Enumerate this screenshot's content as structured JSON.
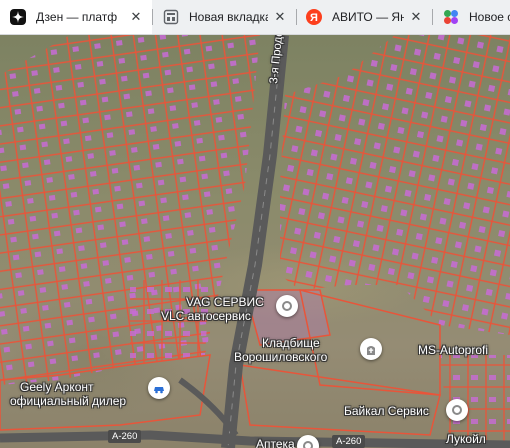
{
  "tabs": [
    {
      "title": "Дзен — платф",
      "favicon": "dzen-icon",
      "active": true
    },
    {
      "title": "Новая вкладка",
      "favicon": "new-tab-icon"
    },
    {
      "title": "АВИТО — Янд",
      "favicon": "yandex-icon"
    },
    {
      "title": "Новое с",
      "favicon": "apps-icon"
    }
  ],
  "map": {
    "street_label": "3-я Продо",
    "pois": [
      {
        "id": "vag",
        "label": "VAG СЕРВИС"
      },
      {
        "id": "vlc",
        "label": "VLC автосервис"
      },
      {
        "id": "cemetery",
        "label_line1": "Кладбище",
        "label_line2": "Ворошиловского"
      },
      {
        "id": "ms",
        "label": "MS-Autoprofi"
      },
      {
        "id": "geely",
        "label_line1": "Geely Арконт",
        "label_line2": "официальный дилер"
      },
      {
        "id": "baikal",
        "label": "Байкал Сервис"
      },
      {
        "id": "lukoil",
        "label": "Лукойл"
      },
      {
        "id": "apteka",
        "label": "Аптека"
      }
    ],
    "road_shields": [
      "А-260",
      "А-260"
    ]
  },
  "colors": {
    "parcel": "#e8553a",
    "building": "#c86bd6",
    "road": "#6a6a6a"
  }
}
